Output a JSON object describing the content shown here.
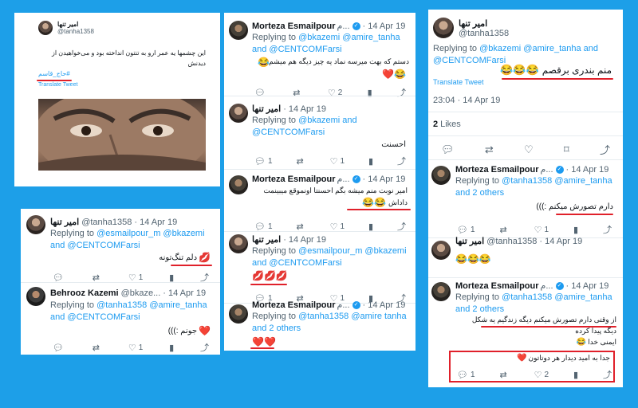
{
  "colors": {
    "background": "#1d9fe8",
    "link": "#1d9bf0",
    "annotation": "#e0202a"
  },
  "p1": {
    "name": "امیر تنها",
    "handle": "@tanha1358",
    "text": "این چشمها یه عمر ارو به تنتون انداخته بود و می‌خواهیدن از دیدنش",
    "hashtag": "#حاج_قاسم",
    "translate": "Translate Tweet"
  },
  "p2": {
    "t1": {
      "name": "Morteza Esmailpour",
      "name_suffix": "م...",
      "date": "· 14 Apr 19",
      "reply_prefix": "Replying to",
      "reply_to": "@bkazemi @amire_tanha and @CENTCOMFarsi",
      "text": "دستم که بهت میرسه نماد یه چیز دیگه هم میشم",
      "emoji": "😂",
      "hearts": "❤️😂",
      "replies": "",
      "retweets": "",
      "likes": "2"
    },
    "t2": {
      "name": "امیر تنها",
      "date": "· 14 Apr 19",
      "reply_prefix": "Replying to",
      "reply_to": "@bkazemi and @CENTCOMFarsi",
      "text": "احسنت",
      "replies": "1",
      "retweets": "",
      "likes": "1"
    },
    "t3": {
      "name": "Morteza Esmailpour",
      "name_suffix": "م...",
      "date": "· 14 Apr 19",
      "text": "امیر نوبت منم میشه بگم احسنتا اونموقع میبینمت",
      "text2": "داداش",
      "emoji": "😂😂",
      "replies": "1",
      "retweets": "",
      "likes": "1"
    },
    "t4": {
      "name": "امیر تنها",
      "date": "· 14 Apr 19",
      "reply_prefix": "Replying to",
      "reply_to": "@esmailpour_m @bkazemi and @CENTCOMFarsi",
      "emoji": "💋💋💋",
      "replies": "1",
      "retweets": "",
      "likes": "1"
    },
    "t5": {
      "name": "Morteza Esmailpour",
      "name_suffix": "م...",
      "date": "· 14 Apr 19",
      "reply_prefix": "Replying to",
      "reply_to": "@tanha1358 @amire tanha and 2 others",
      "emoji": "❤️❤️"
    }
  },
  "p3": {
    "name": "امیر تنها",
    "handle": "@tanha1358",
    "reply_prefix": "Replying to",
    "reply_to": "@bkazemi @amire_tanha and @CENTCOMFarsi",
    "text": "منم بندری برقصم",
    "emoji": "😂😂😂",
    "translate": "Translate Tweet",
    "timestamp": "23:04 · 14 Apr 19",
    "likes_count": "2",
    "likes_label": "Likes",
    "t2": {
      "name": "Morteza Esmailpour",
      "name_suffix": "م...",
      "date": "· 14 Apr 19",
      "reply_prefix": "Replying to",
      "reply_to": "@tanha1358 @amire_tanha and 2 others",
      "text": "دارم تصورش میکنم :)))",
      "replies": "1",
      "retweets": "",
      "likes": "1"
    },
    "t3": {
      "name": "امیر تنها",
      "handle": "@tanha1358",
      "date": "· 14 Apr 19",
      "emoji": "😂😂😂"
    },
    "t4": {
      "name": "Morteza Esmailpour",
      "name_suffix": "م...",
      "date": "· 14 Apr 19",
      "reply_prefix": "Replying to",
      "reply_to": "@tanha1358 @amire_tanha and 2 others",
      "line1": "از وقتی دارم تصورش میکنم دیگه زندگیم یه شکل",
      "line2": "دیگه پیدا کرده",
      "line3": "ایمنی خدا",
      "emoji3": "😂",
      "line4": "جدا به امید دیدار هر دوتاتون",
      "heart": "❤️",
      "replies": "1",
      "retweets": "",
      "likes": "2"
    }
  },
  "p4": {
    "t1": {
      "name": "امیر تنها",
      "handle": "@tanha1358",
      "date": "· 14 Apr 19",
      "reply_prefix": "Replying to",
      "reply_to": "@esmailpour_m @bkazemi and @CENTCOMFarsi",
      "text": "دلم تنگ‌تونه",
      "emoji": "💋",
      "replies": "",
      "retweets": "",
      "likes": "1"
    },
    "t2": {
      "name": "Behrooz Kazemi",
      "handle": "@bkaze...",
      "date": "· 14 Apr 19",
      "reply_prefix": "Replying to",
      "reply_to": "@tanha1358 @amire_tanha and @CENTCOMFarsi",
      "text": "جونم :)))",
      "emoji": "❤️",
      "replies": "",
      "retweets": "",
      "likes": "1"
    }
  },
  "icons": {
    "reply": "reply-icon",
    "retweet": "retweet-icon",
    "like": "heart-icon",
    "views": "views-icon",
    "share": "share-icon"
  }
}
